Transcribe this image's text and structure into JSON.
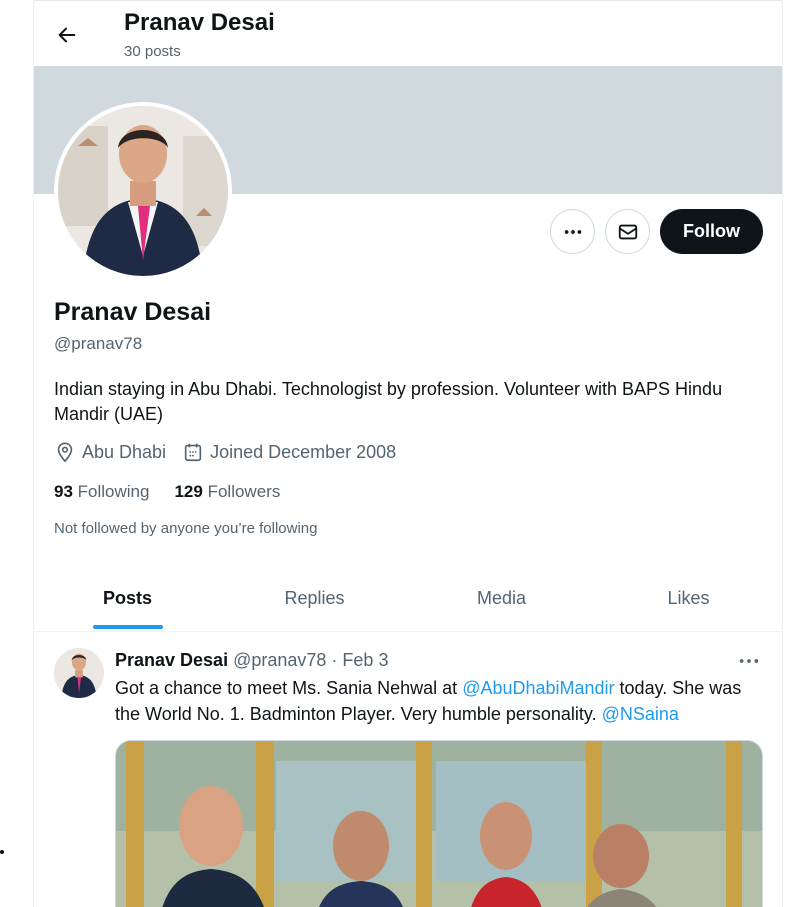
{
  "header": {
    "name": "Pranav Desai",
    "posts_count": "30 posts"
  },
  "profile": {
    "name": "Pranav Desai",
    "handle": "@pranav78",
    "bio": "Indian staying in Abu Dhabi. Technologist by profession. Volunteer with BAPS Hindu Mandir (UAE)",
    "location": "Abu Dhabi",
    "joined": "Joined December 2008",
    "following_count": "93",
    "following_label": "Following",
    "followers_count": "129",
    "followers_label": "Followers",
    "not_followed_text": "Not followed by anyone you’re following"
  },
  "actions": {
    "more_icon": "more-horizontal-icon",
    "message_icon": "envelope-icon",
    "follow_label": "Follow"
  },
  "tabs": [
    {
      "label": "Posts",
      "active": true
    },
    {
      "label": "Replies",
      "active": false
    },
    {
      "label": "Media",
      "active": false
    },
    {
      "label": "Likes",
      "active": false
    }
  ],
  "tweet": {
    "author_name": "Pranav Desai",
    "author_handle": "@pranav78",
    "separator": "·",
    "date": "Feb 3",
    "text_part1": "Got a chance to meet Ms. Sania Nehwal at ",
    "mention1": "@AbuDhabiMandir",
    "text_part2": " today. She was the World No. 1. Badminton Player. Very humble personality. ",
    "mention2": "@NSaina"
  },
  "colors": {
    "accent": "#1d9bf0",
    "text_primary": "#0f1419",
    "text_secondary": "#536471",
    "banner": "#cfd9de",
    "follow_button": "#0f1419"
  }
}
